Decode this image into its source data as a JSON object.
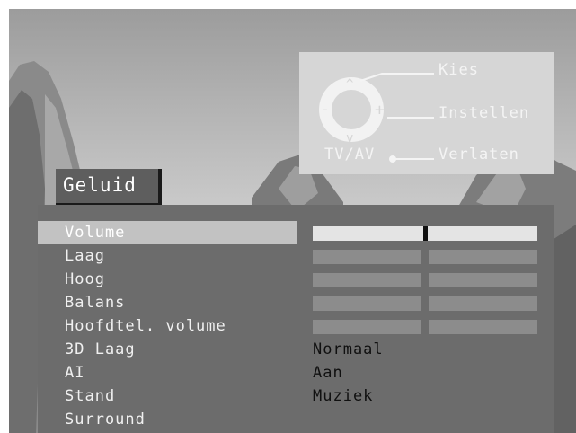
{
  "help": {
    "select_label": "Kies",
    "adjust_label": "Instellen",
    "exit_label": "Verlaten",
    "exit_button_label": "TV/AV"
  },
  "menu": {
    "title": "Geluid",
    "items": [
      {
        "label": "Volume",
        "selected": true,
        "level": 0.5
      },
      {
        "label": "Laag"
      },
      {
        "label": "Hoog"
      },
      {
        "label": "Balans"
      },
      {
        "label": "Hoofdtel. volume"
      },
      {
        "label": "3D Laag",
        "value": "Normaal"
      },
      {
        "label": "AI",
        "value": "Aan"
      },
      {
        "label": "Stand",
        "value": "Muziek"
      },
      {
        "label": "Surround"
      }
    ]
  }
}
